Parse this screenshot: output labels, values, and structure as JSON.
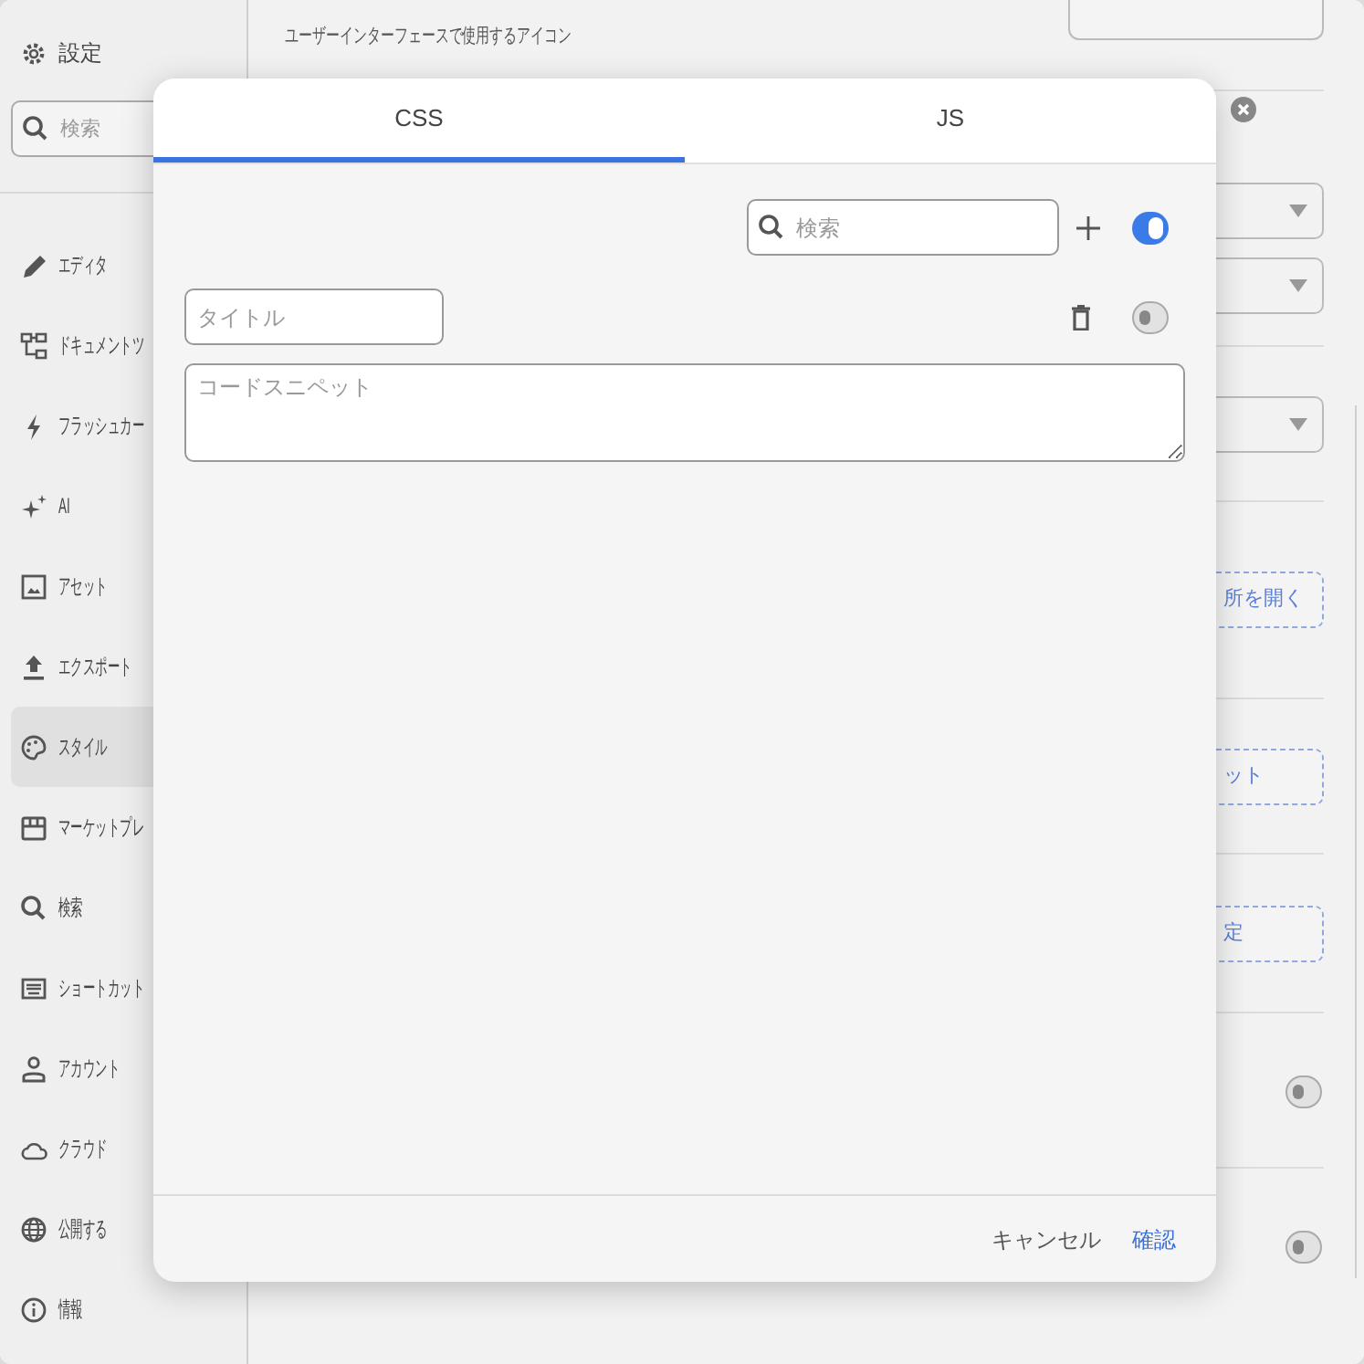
{
  "sidebar": {
    "title": "設定",
    "search": {
      "placeholder": "検索"
    },
    "items": [
      {
        "label": "エディタ",
        "selected": false
      },
      {
        "label": "ドキュメントツ",
        "selected": false
      },
      {
        "label": "フラッシュカー",
        "selected": false
      },
      {
        "label": "AI",
        "selected": false
      },
      {
        "label": "アセット",
        "selected": false
      },
      {
        "label": "エクスポート",
        "selected": false
      },
      {
        "label": "スタイル",
        "selected": true
      },
      {
        "label": "マーケットプレ",
        "selected": false
      },
      {
        "label": "検索",
        "selected": false
      },
      {
        "label": "ショートカット",
        "selected": false
      },
      {
        "label": "アカウント",
        "selected": false
      },
      {
        "label": "クラウド",
        "selected": false
      },
      {
        "label": "公開する",
        "selected": false
      },
      {
        "label": "情報",
        "selected": false
      }
    ]
  },
  "settings_panel": {
    "caption": "ユーザーインターフェースで使用するアイコン",
    "buttons": [
      {
        "label": "所を開く"
      },
      {
        "label": "ット"
      },
      {
        "label": "定"
      }
    ],
    "toggles": [
      {
        "on": false
      },
      {
        "on": false
      }
    ]
  },
  "dialog": {
    "tabs": [
      {
        "label": "CSS",
        "selected": true
      },
      {
        "label": "JS",
        "selected": false
      }
    ],
    "search": {
      "placeholder": "検索"
    },
    "all_enabled": {
      "on": true
    },
    "snippet": {
      "title_placeholder": "タイトル",
      "code_placeholder": "コードスニペット",
      "enabled": {
        "on": false
      }
    },
    "buttons": [
      {
        "label": "キャンセル",
        "kind": "secondary"
      },
      {
        "label": "確認",
        "kind": "primary"
      }
    ]
  }
}
